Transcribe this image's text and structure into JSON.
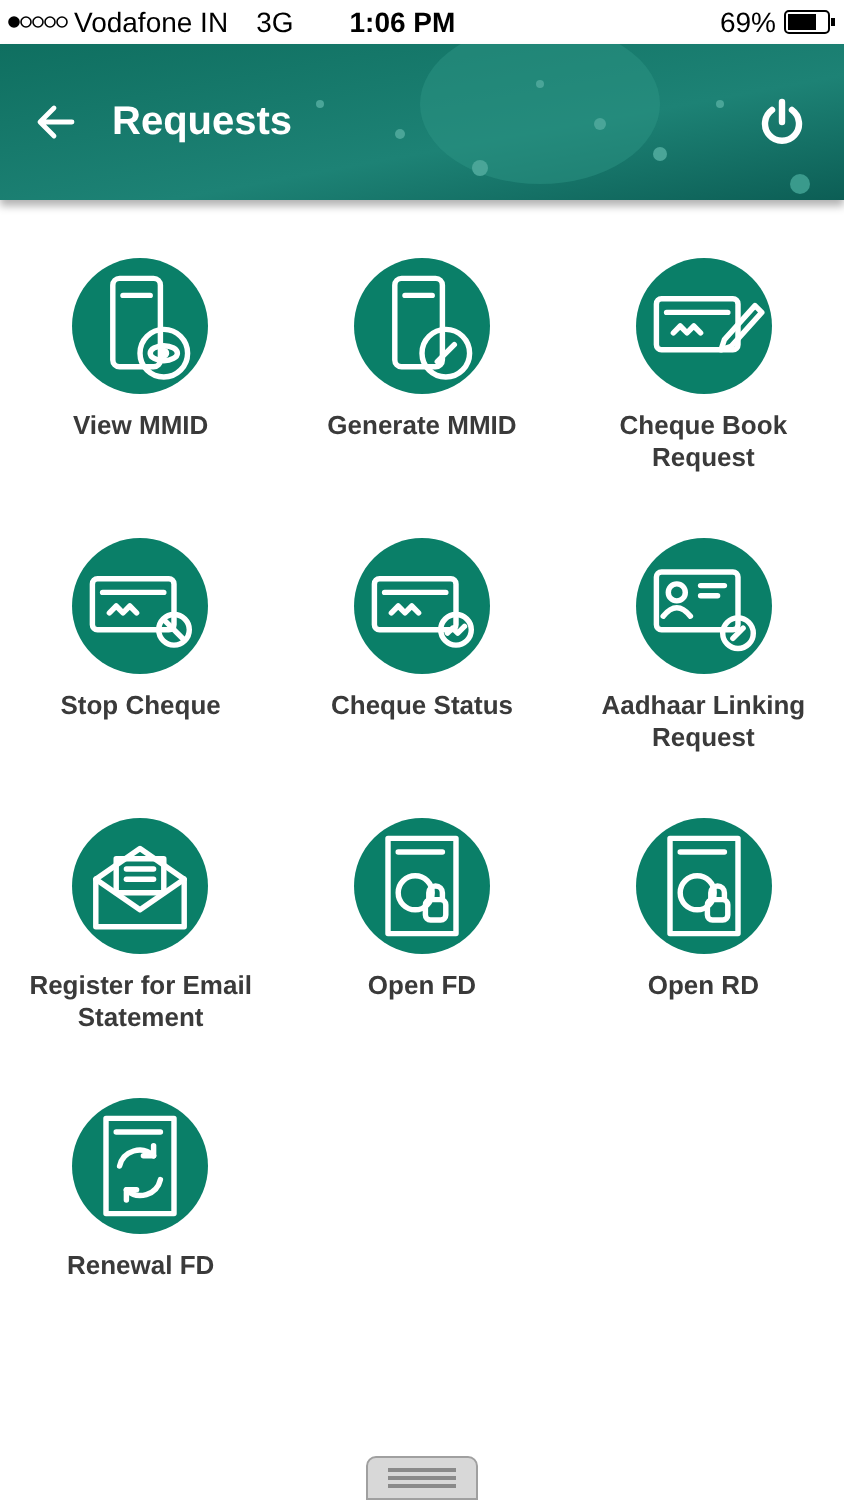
{
  "status_bar": {
    "carrier": "Vodafone IN",
    "network": "3G",
    "time": "1:06 PM",
    "battery": "69%"
  },
  "header": {
    "title": "Requests"
  },
  "items": [
    {
      "label": "View MMID",
      "kind": "view_mmid"
    },
    {
      "label": "Generate MMID",
      "kind": "generate_mmid"
    },
    {
      "label": "Cheque Book Request",
      "kind": "cheque_book"
    },
    {
      "label": "Stop Cheque",
      "kind": "stop_cheque"
    },
    {
      "label": "Cheque Status",
      "kind": "cheque_status"
    },
    {
      "label": "Aadhaar Linking Request",
      "kind": "aadhaar"
    },
    {
      "label": "Register for Email Statement",
      "kind": "email"
    },
    {
      "label": "Open FD",
      "kind": "deposit"
    },
    {
      "label": "Open RD",
      "kind": "deposit"
    },
    {
      "label": "Renewal FD",
      "kind": "renewal"
    }
  ]
}
